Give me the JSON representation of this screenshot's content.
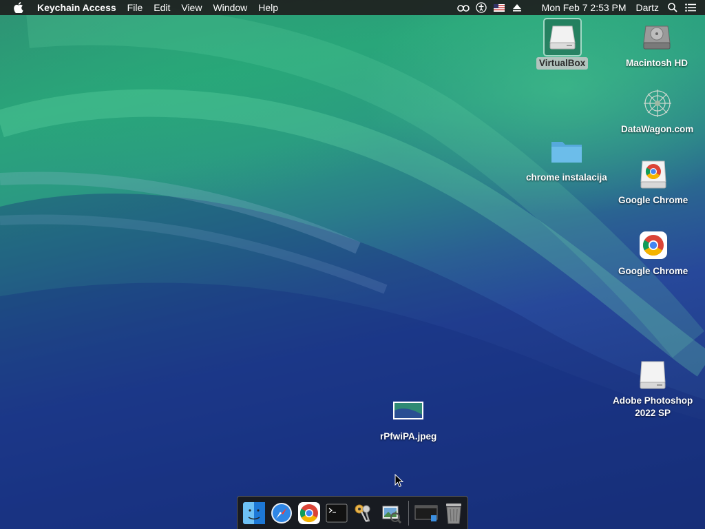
{
  "menubar": {
    "app_name": "Keychain Access",
    "menus": [
      "File",
      "Edit",
      "View",
      "Window",
      "Help"
    ],
    "clock": "Mon Feb 7  2:53 PM",
    "user": "Dartz",
    "status_icons": [
      "binoculars-icon",
      "accessibility-icon",
      "flag-icon",
      "eject-icon"
    ]
  },
  "desktop": {
    "icons": [
      {
        "label": "VirtualBox",
        "icon": "drive-icon",
        "selected": true
      },
      {
        "label": "Macintosh HD",
        "icon": "hard-disk-icon"
      },
      {
        "label": "DataWagon.com",
        "icon": "network-icon"
      },
      {
        "label": "chrome instalacija",
        "icon": "folder-icon"
      },
      {
        "label": "Google Chrome",
        "icon": "chrome-drive-icon"
      },
      {
        "label": "Google Chrome",
        "icon": "chrome-icon"
      },
      {
        "label": "Adobe Photoshop 2022 SP",
        "label_line1": "Adobe Photoshop",
        "label_line2": "2022 SP",
        "icon": "drive-icon"
      },
      {
        "label": "rPfwiPA.jpeg",
        "icon": "image-file-icon"
      }
    ]
  },
  "dock": {
    "apps": [
      "Finder",
      "Safari",
      "Google Chrome",
      "Terminal",
      "Keychain Access",
      "Preview",
      "Screen",
      "Trash"
    ]
  },
  "colors": {
    "menubar": "#1e1e1e",
    "wallpaper_top": "#29a57a",
    "wallpaper_bottom": "#1f3a83"
  }
}
